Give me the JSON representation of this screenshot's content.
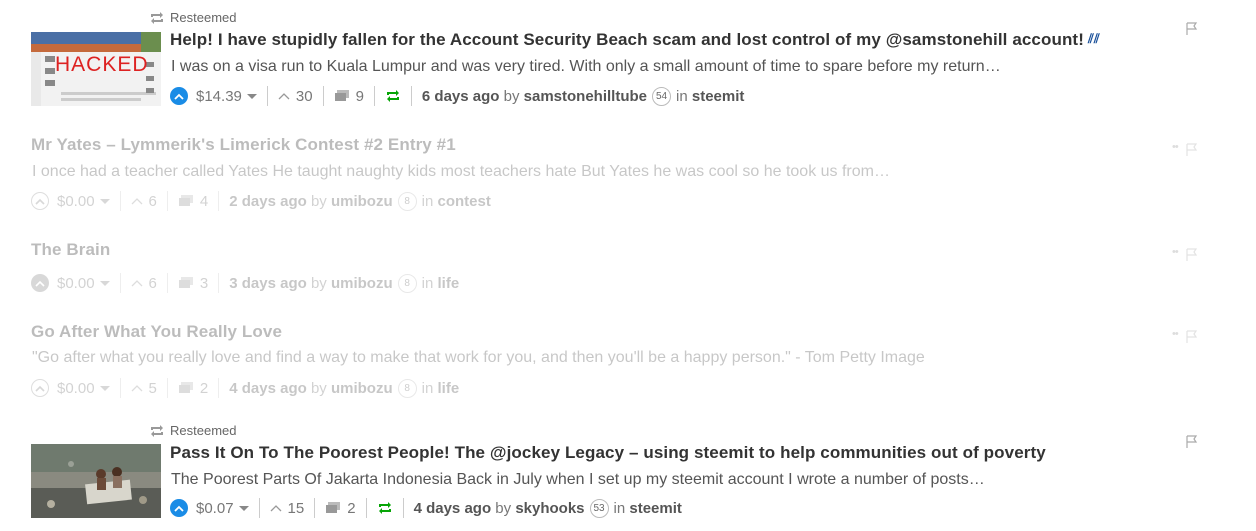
{
  "posts": [
    {
      "resteemed": true,
      "resteem_label": "Resteemed",
      "title": "Help! I have stupidly fallen for the Account Security Beach scam and lost control of my @samstonehill account!",
      "summary": "I was on a visa run to Kuala Lumpur and was very tired. With only a small amount of time to spare before my return…",
      "payout": "$14.39",
      "votes": "30",
      "comments": "9",
      "age": "6 days ago",
      "by": "by",
      "author": "samstonehilltube",
      "reputation": "54",
      "in": "in",
      "category": "steemit",
      "thumb_text": "HACKED"
    },
    {
      "resteemed": false,
      "title": "Mr Yates – Lymmerik's Limerick Contest #2 Entry #1",
      "summary": "I once had a teacher called Yates He taught naughty kids most teachers hate But Yates he was cool so he took us from…",
      "payout": "$0.00",
      "votes": "6",
      "comments": "4",
      "age": "2 days ago",
      "by": "by",
      "author": "umibozu",
      "reputation": "8",
      "in": "in",
      "category": "contest"
    },
    {
      "resteemed": false,
      "title": "The Brain",
      "summary": "",
      "payout": "$0.00",
      "votes": "6",
      "comments": "3",
      "age": "3 days ago",
      "by": "by",
      "author": "umibozu",
      "reputation": "8",
      "in": "in",
      "category": "life"
    },
    {
      "resteemed": false,
      "title": "Go After What You Really Love",
      "summary": "\"Go after what you really love and find a way to make that work for you, and then you'll be a happy person.\" - Tom Petty Image",
      "payout": "$0.00",
      "votes": "5",
      "comments": "2",
      "age": "4 days ago",
      "by": "by",
      "author": "umibozu",
      "reputation": "8",
      "in": "in",
      "category": "life"
    },
    {
      "resteemed": true,
      "resteem_label": "Resteemed",
      "title": "Pass It On To The Poorest People! The @jockey Legacy – using steemit to help communities out of poverty",
      "summary": "The Poorest Parts Of Jakarta Indonesia Back in July when I set up my steemit account I wrote a number of posts…",
      "payout": "$0.07",
      "votes": "15",
      "comments": "2",
      "age": "4 days ago",
      "by": "by",
      "author": "skyhooks",
      "reputation": "53",
      "in": "in",
      "category": "steemit"
    }
  ],
  "colors": {
    "accent": "#1a8ce6",
    "resteem_green": "#07a507",
    "title": "#333333"
  }
}
